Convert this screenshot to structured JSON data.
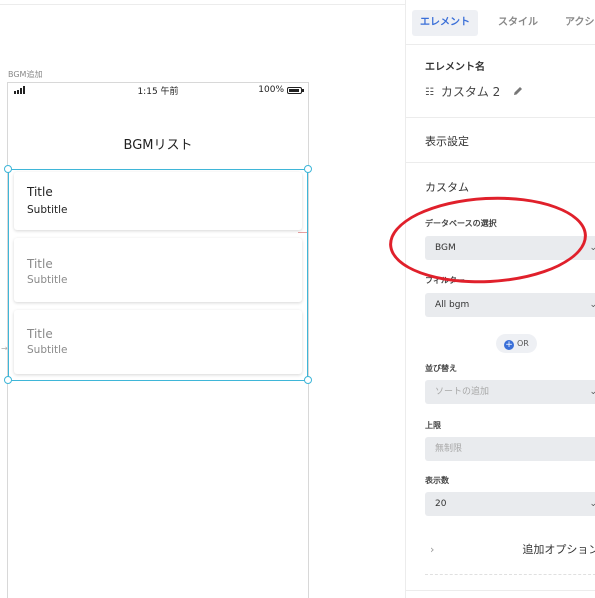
{
  "canvas": {
    "screen_label": "BGM追加",
    "status": {
      "time": "1:15 午前",
      "battery": "100%"
    },
    "nav_title": "BGMリスト",
    "cards": [
      {
        "title": "Title",
        "subtitle": "Subtitle"
      },
      {
        "title": "Title",
        "subtitle": "Subtitle"
      },
      {
        "title": "Title",
        "subtitle": "Subtitle"
      }
    ]
  },
  "panel": {
    "tabs": [
      "エレメント",
      "スタイル",
      "アクション"
    ],
    "element_name_label": "エレメント名",
    "element_name_value": "カスタム 2",
    "display_settings": "表示設定",
    "custom": "カスタム",
    "db_label": "データベースの選択",
    "db_value": "BGM",
    "filter_label": "フィルター",
    "filter_value": "All bgm",
    "or_label": "OR",
    "sort_label": "並び替え",
    "sort_placeholder": "ソートの追加",
    "limit_label": "上限",
    "limit_placeholder": "無制限",
    "count_label": "表示数",
    "count_value": "20",
    "more_options": "追加オプション"
  },
  "colors": {
    "accent": "#3a6fd8",
    "selection": "#3fb6d8",
    "annotation": "#e0202b"
  },
  "icons": [
    "signal-icon",
    "battery-icon",
    "list-icon",
    "pencil-icon",
    "chevron-down-icon",
    "plus-icon",
    "chevron-right-icon"
  ]
}
